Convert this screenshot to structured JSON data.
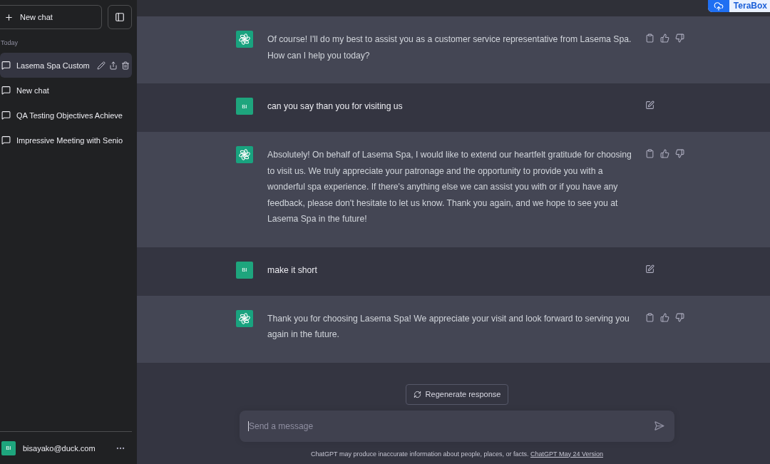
{
  "extension_badge": {
    "label": "TeraBox"
  },
  "sidebar": {
    "new_chat_button": "New chat",
    "section_label": "Today",
    "conversations": [
      {
        "title": "Lasema Spa Custom",
        "selected": true
      },
      {
        "title": "New chat",
        "selected": false
      },
      {
        "title": "QA Testing Objectives Achieve",
        "selected": false
      },
      {
        "title": "Impressive Meeting with Senio",
        "selected": false
      }
    ],
    "account": {
      "avatar_initials": "BI",
      "email": "bisayako@duck.com"
    }
  },
  "messages": [
    {
      "kind": "assistant",
      "text": "Of course! I'll do my best to assist you as a customer service representative from Lasema Spa. How can I help you today?"
    },
    {
      "kind": "user",
      "avatar_initials": "BI",
      "text": "can you say than you for visiting us"
    },
    {
      "kind": "assistant",
      "text": "Absolutely! On behalf of Lasema Spa, I would like to extend our heartfelt gratitude for choosing to visit us. We truly appreciate your patronage and the opportunity to provide you with a wonderful spa experience. If there's anything else we can assist you with or if you have any feedback, please don't hesitate to let us know. Thank you again, and we hope to see you at Lasema Spa in the future!"
    },
    {
      "kind": "user",
      "avatar_initials": "BI",
      "text": "make it short"
    },
    {
      "kind": "assistant",
      "text": "Thank you for choosing Lasema Spa! We appreciate your visit and look forward to serving you again in the future."
    }
  ],
  "regenerate_button": "Regenerate response",
  "composer": {
    "placeholder": "Send a message"
  },
  "footer": {
    "text": "ChatGPT may produce inaccurate information about people, places, or facts.",
    "link": "ChatGPT May 24 Version"
  }
}
